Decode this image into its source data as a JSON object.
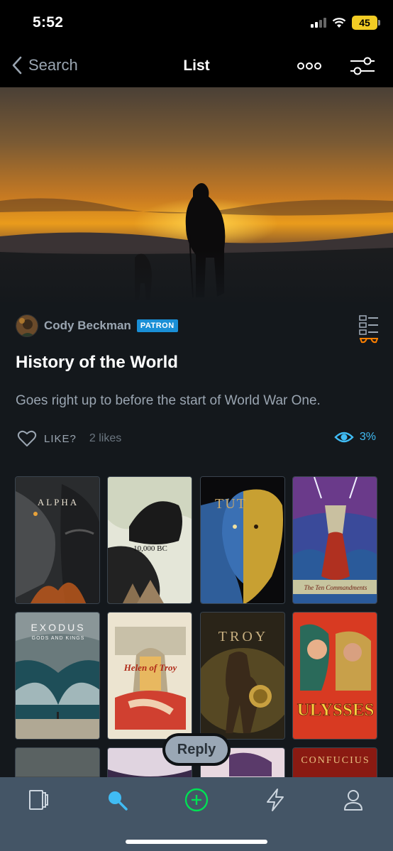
{
  "status_bar": {
    "time": "5:52",
    "battery": "45"
  },
  "nav": {
    "back_label": "Search",
    "title": "List"
  },
  "author": {
    "name": "Cody Beckman",
    "badge": "PATRON"
  },
  "list": {
    "title": "History of the World",
    "description": "Goes right up to before the start of World War One."
  },
  "actions": {
    "like_label": "LIKE?",
    "likes_count": "2 likes",
    "watched_percent": "3%"
  },
  "posters": [
    {
      "title": "ALPHA"
    },
    {
      "title": "10,000 BC"
    },
    {
      "title": "TUT"
    },
    {
      "title": "The Ten Commandments"
    },
    {
      "title": "EXODUS",
      "subtitle": "GODS AND KINGS"
    },
    {
      "title": "Helen of Troy"
    },
    {
      "title": "TROY"
    },
    {
      "title": "ULYSSES"
    },
    {
      "title": ""
    },
    {
      "title": ""
    },
    {
      "title": ""
    },
    {
      "title": "CONFUCIUS"
    }
  ],
  "reply_label": "Reply",
  "tab_bar": {
    "icons": [
      "films-icon",
      "search-icon",
      "add-icon",
      "activity-icon",
      "profile-icon"
    ],
    "active": "search-icon"
  },
  "colors": {
    "accent_blue": "#40bcf4",
    "accent_green": "#00e054",
    "accent_orange": "#ff8000",
    "background": "#14181c"
  }
}
